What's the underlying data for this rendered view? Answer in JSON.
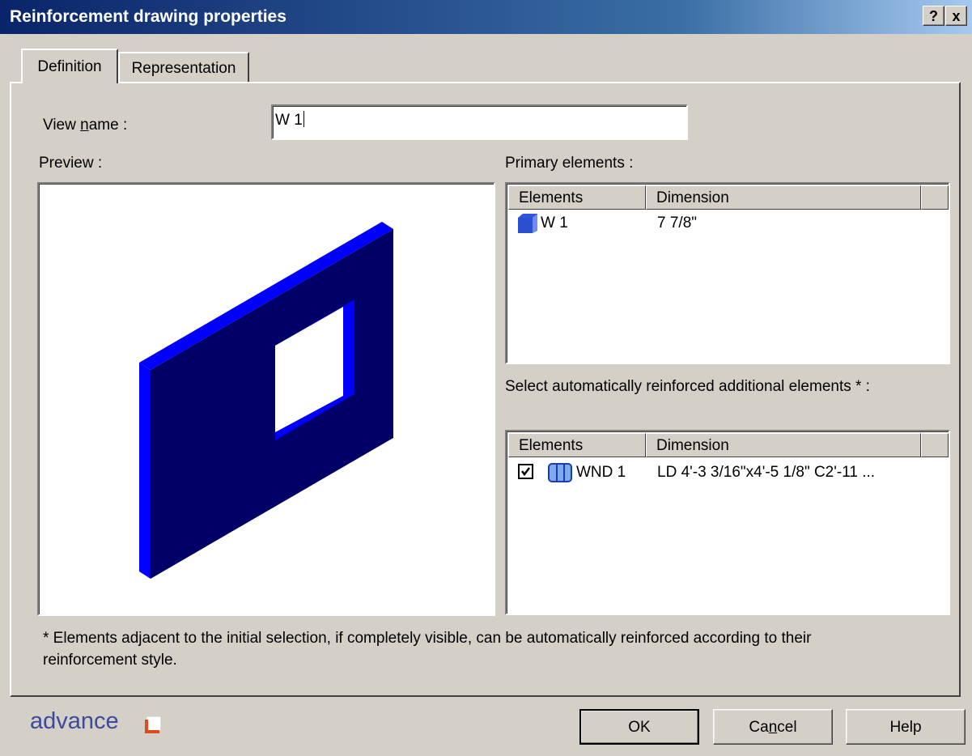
{
  "window": {
    "title": "Reinforcement drawing properties",
    "help_glyph": "?",
    "close_glyph": "x"
  },
  "tabs": [
    {
      "label": "Definition",
      "active": true
    },
    {
      "label": "Representation",
      "active": false
    }
  ],
  "view_name": {
    "label_pre": "View ",
    "label_accel": "n",
    "label_post": "ame :",
    "value": "W 1"
  },
  "preview": {
    "label": "Preview :"
  },
  "primary": {
    "label": "Primary elements :",
    "columns": [
      "Elements",
      "Dimension"
    ],
    "rows": [
      {
        "icon": "wall-icon",
        "element": "W 1",
        "dimension": "7 7/8\""
      }
    ]
  },
  "additional": {
    "label": "Select automatically reinforced additional elements * :",
    "columns": [
      "Elements",
      "Dimension"
    ],
    "rows": [
      {
        "checked": true,
        "icon": "window-icon",
        "element": "WND 1",
        "dimension": "LD 4'-3 3/16\"x4'-5 1/8\" C2'-11 ..."
      }
    ]
  },
  "footnote": {
    "line1": "* Elements adjacent to the initial selection, if completely visible, can be automatically reinforced according to their",
    "line2": "reinforcement style."
  },
  "logo": {
    "text": "advance"
  },
  "buttons": {
    "ok": "OK",
    "cancel_pre": "Ca",
    "cancel_accel": "n",
    "cancel_post": "cel",
    "help": "Help"
  },
  "colors": {
    "wall_front": "#000066",
    "wall_edge": "#0000ff",
    "title_start": "#0a246a",
    "logo": "#3c4a9b"
  }
}
